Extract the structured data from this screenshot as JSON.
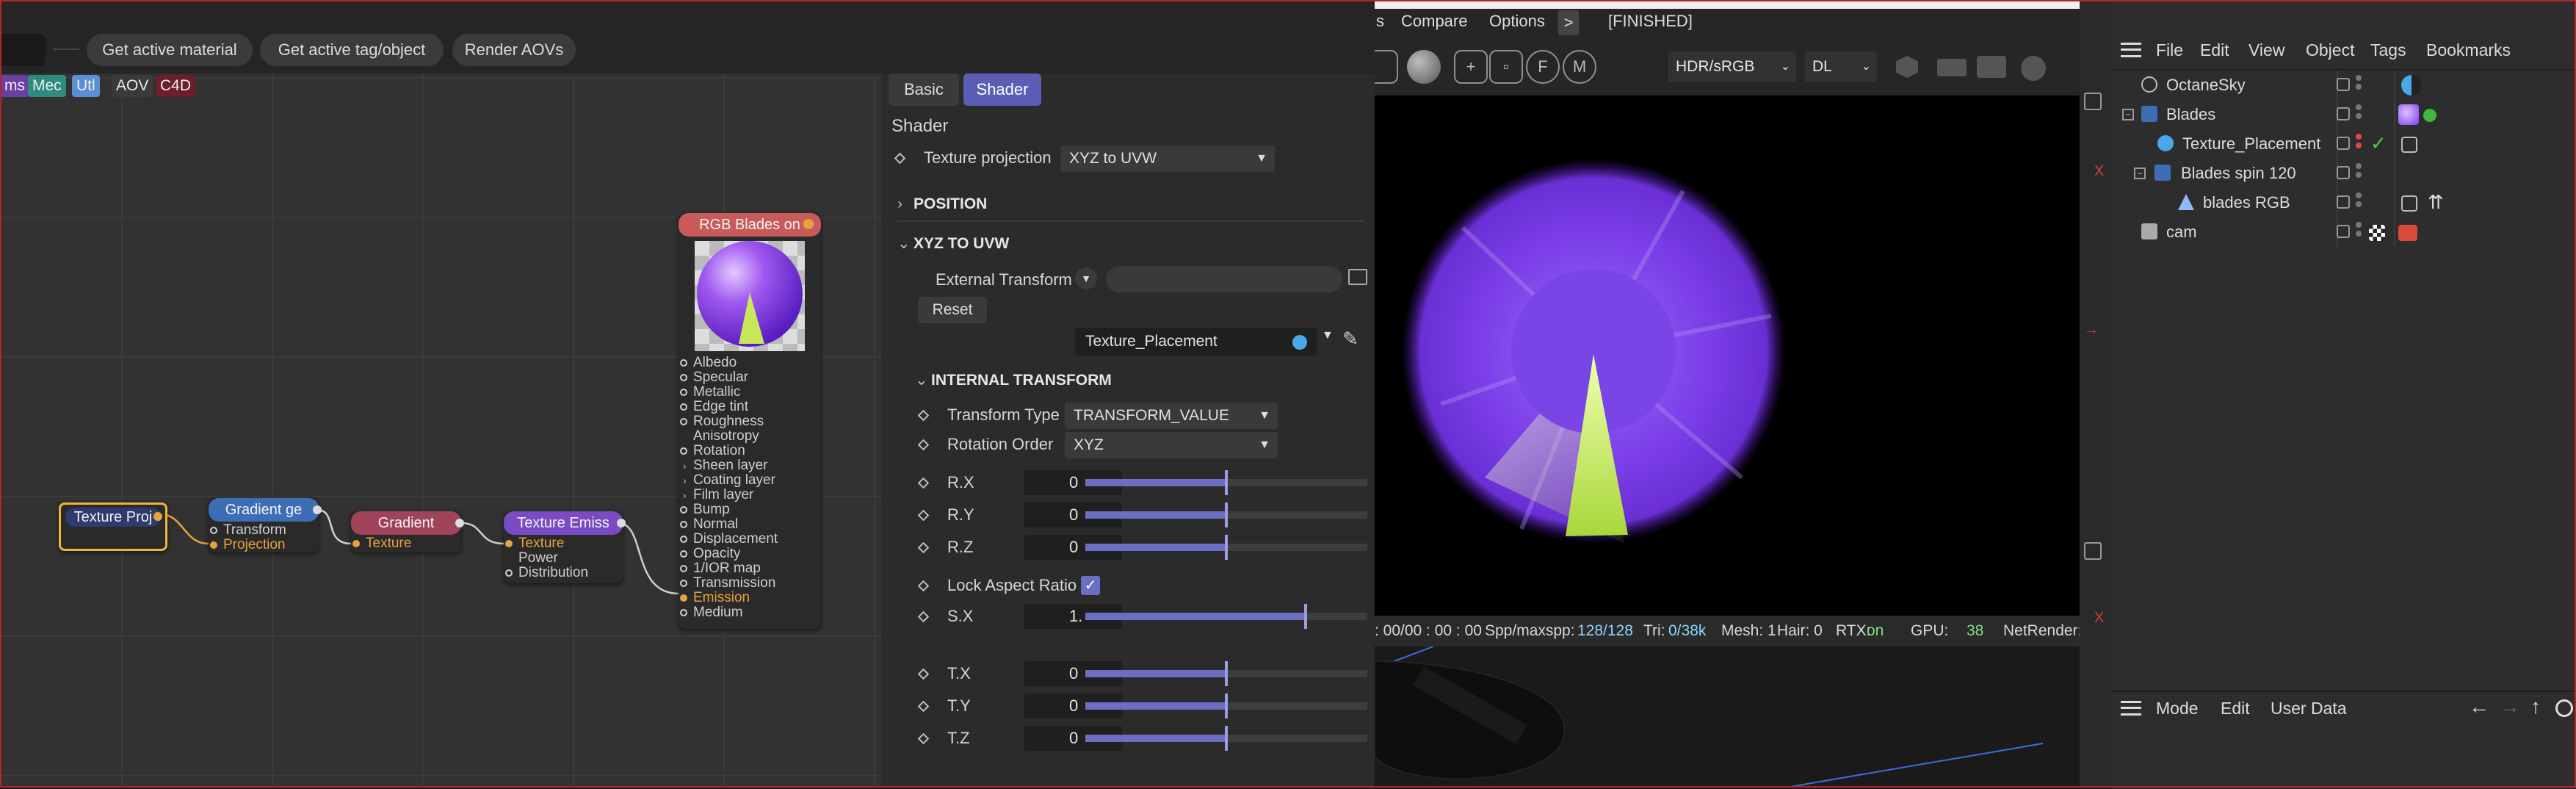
{
  "node_editor": {
    "toolbar": {
      "get_active_material": "Get active material",
      "get_active_tag": "Get active tag/object",
      "render_aovs": "Render AOVs"
    },
    "categories": [
      {
        "label": "ms",
        "color": "#6b3fa0"
      },
      {
        "label": "Mec",
        "color": "#2f8a7f"
      },
      {
        "label": "Utl",
        "color": "#5a8fd4"
      },
      {
        "label": "AOV",
        "color": "#3a3a3a"
      },
      {
        "label": "C4D",
        "color": "#6e1e2a"
      }
    ],
    "nodes": {
      "texture_proj": {
        "title": "Texture Proj",
        "color": "#2f3b6e"
      },
      "gradient_gen": {
        "title": "Gradient ge",
        "color": "#3d6db5",
        "ports": [
          "Transform",
          "Projection"
        ]
      },
      "gradient": {
        "title": "Gradient",
        "color": "#a1435a",
        "ports": [
          "Texture"
        ]
      },
      "texture_emission": {
        "title": "Texture Emiss",
        "color": "#7a4bc4",
        "ports": [
          "Texture",
          "Power",
          "Distribution"
        ]
      },
      "rgb_blades": {
        "title": "RGB Blades on",
        "color": "#c85a5a",
        "ports": [
          "Albedo",
          "Specular",
          "Metallic",
          "Edge tint",
          "Roughness",
          "Anisotropy",
          "Rotation",
          "Sheen layer",
          "Coating layer",
          "Film layer",
          "Bump",
          "Normal",
          "Displacement",
          "Opacity",
          "1/IOR map",
          "Transmission",
          "Emission",
          "Medium"
        ]
      }
    }
  },
  "attributes": {
    "tabs": {
      "basic": "Basic",
      "shader": "Shader"
    },
    "heading": "Shader",
    "texture_projection": {
      "label": "Texture projection",
      "value": "XYZ to UVW"
    },
    "sections": {
      "position": "POSITION",
      "xyz_to_uvw": "XYZ TO UVW",
      "internal_transform": "INTERNAL TRANSFORM"
    },
    "external_transform": {
      "label": "External Transform",
      "reset": "Reset",
      "link": "Texture_Placement"
    },
    "transform_type": {
      "label": "Transform Type",
      "value": "TRANSFORM_VALUE"
    },
    "rotation_order": {
      "label": "Rotation Order",
      "value": "XYZ"
    },
    "params": [
      {
        "label": "R.X",
        "value": "0",
        "fill": 0.5
      },
      {
        "label": "R.Y",
        "value": "0",
        "fill": 0.5
      },
      {
        "label": "R.Z",
        "value": "0",
        "fill": 0.5
      }
    ],
    "lock_aspect_ratio": {
      "label": "Lock Aspect Ratio",
      "checked": true
    },
    "scale": {
      "label": "S.X",
      "value": "1.",
      "fill": 0.78
    },
    "translate": [
      {
        "label": "T.X",
        "value": "0",
        "fill": 0.5
      },
      {
        "label": "T.Y",
        "value": "0",
        "fill": 0.5
      },
      {
        "label": "T.Z",
        "value": "0",
        "fill": 0.5
      }
    ]
  },
  "viewport": {
    "menu": {
      "s": "s",
      "compare": "Compare",
      "options": "Options",
      "more": ">",
      "status": "[FINISHED]"
    },
    "selects": {
      "color_space": "HDR/sRGB",
      "kernel": "DL"
    },
    "status_bar": {
      "time": ": 00/00 : 00 : 00",
      "spp_label": "Spp/maxspp:",
      "spp_value": "128/128",
      "tri_label": "Tri:",
      "tri_value": "0/38k",
      "mesh": "Mesh: 1",
      "hair": "Hair: 0",
      "rtx_label": "RTX:",
      "rtx_value": "on",
      "gpu_label": "GPU:",
      "gpu_value": "38",
      "netrender": "NetRender:"
    },
    "colors": {
      "purple": "#7b3ee8",
      "green": "#b8e04a"
    }
  },
  "object_manager": {
    "menu": {
      "file": "File",
      "edit": "Edit",
      "view": "View",
      "object": "Object",
      "tags": "Tags",
      "bookmarks": "Bookmarks"
    },
    "objects": [
      {
        "name": "OctaneSky",
        "indent": 0
      },
      {
        "name": "Blades",
        "indent": 0
      },
      {
        "name": "Texture_Placement",
        "indent": 1
      },
      {
        "name": "Blades spin 120",
        "indent": 1
      },
      {
        "name": "blades RGB",
        "indent": 2
      },
      {
        "name": "cam",
        "indent": 0
      }
    ]
  },
  "attribute_manager": {
    "menu": {
      "mode": "Mode",
      "edit": "Edit",
      "user_data": "User Data"
    }
  }
}
